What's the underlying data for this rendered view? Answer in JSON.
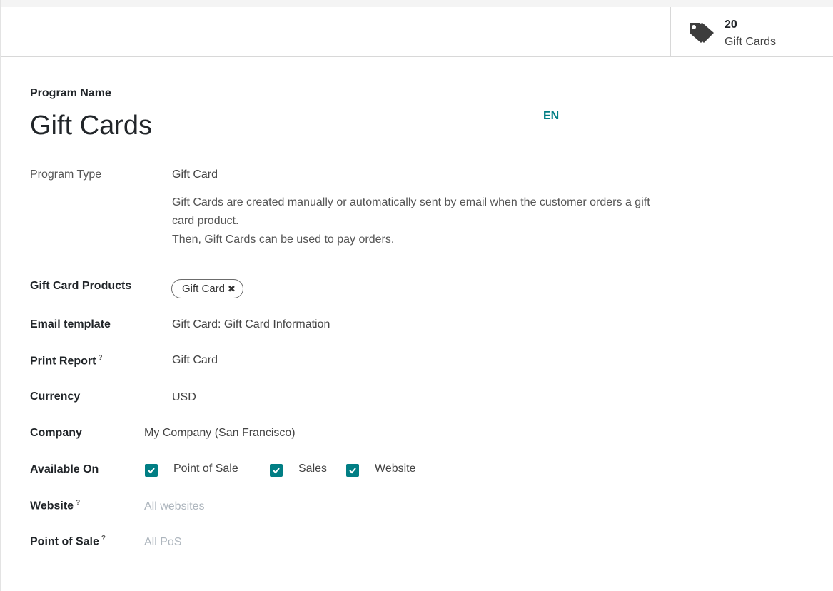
{
  "smart_button": {
    "count": "20",
    "label": "Gift Cards",
    "icon": "tags-icon"
  },
  "program_name": {
    "label": "Program Name",
    "value": "Gift Cards",
    "lang": "EN"
  },
  "program_type": {
    "label": "Program Type",
    "value": "Gift Card",
    "description_lines": [
      "Gift Cards are created manually or automatically sent by email when the customer orders a gift",
      "card product.",
      "Then, Gift Cards can be used to pay orders."
    ]
  },
  "gift_card_products": {
    "label": "Gift Card Products",
    "tags": [
      "Gift Card"
    ],
    "remove_symbol": "✖"
  },
  "email_template": {
    "label": "Email template",
    "value": "Gift Card: Gift Card Information"
  },
  "print_report": {
    "label": "Print Report",
    "help": "?",
    "value": "Gift Card"
  },
  "currency": {
    "label": "Currency",
    "value": "USD"
  },
  "company": {
    "label": "Company",
    "value": "My Company (San Francisco)"
  },
  "available_on": {
    "label": "Available On",
    "options": [
      {
        "label": "Point of Sale",
        "checked": true
      },
      {
        "label": "Sales",
        "checked": true
      },
      {
        "label": "Website",
        "checked": true
      }
    ]
  },
  "website": {
    "label": "Website",
    "help": "?",
    "placeholder": "All websites"
  },
  "point_of_sale": {
    "label": "Point of Sale",
    "help": "?",
    "placeholder": "All PoS"
  },
  "colors": {
    "accent": "#017e84"
  }
}
